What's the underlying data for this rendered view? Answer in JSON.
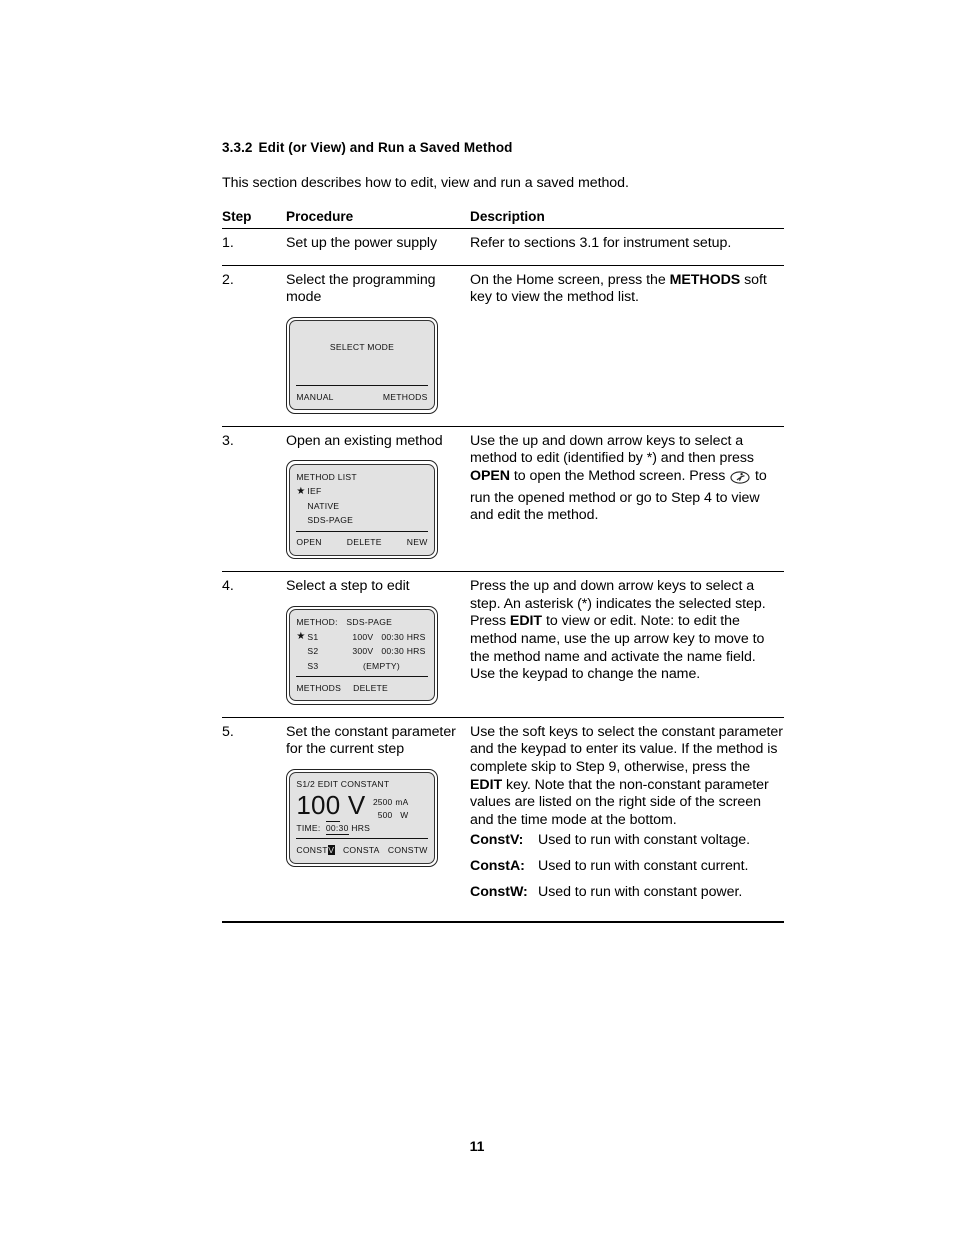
{
  "section": {
    "number": "3.3.2",
    "title": "Edit (or View) and Run a Saved Method",
    "intro": "This section describes how to edit, view and run a saved method."
  },
  "table": {
    "headers": {
      "step": "Step",
      "procedure": "Procedure",
      "description": "Description"
    },
    "rows": [
      {
        "step": "1.",
        "procedure": "Set up the power supply",
        "description": "Refer to sections 3.1 for instrument setup."
      },
      {
        "step": "2.",
        "procedure": "Select the programming mode",
        "desc_pre": "On the Home screen, press the ",
        "desc_bold": "METHODS",
        "desc_post": " soft key to view the method list."
      },
      {
        "step": "3.",
        "procedure": "Open an existing method",
        "desc_part1": "Use the up and down arrow keys to select a method to edit (identified by *) and then press ",
        "desc_bold": "OPEN",
        "desc_part2": " to open the Method screen. Press ",
        "desc_part3": " to run the opened method or go to Step 4 to view and edit the method."
      },
      {
        "step": "4.",
        "procedure": "Select a step to edit",
        "desc_part1": "Press the up and down arrow keys to select a step. An asterisk (*) indicates the selected step. Press ",
        "desc_bold": "EDIT",
        "desc_part2": " to view or edit. Note: to edit the method name, use the up arrow key to move to the method name and activate the name field. Use the keypad to change the name."
      },
      {
        "step": "5.",
        "procedure": "Set the constant parameter for the current step",
        "desc_part1": "Use the soft keys to select the constant parameter and the keypad to enter its value. If the method is complete skip to Step 9, otherwise, press the ",
        "desc_bold": "EDIT",
        "desc_part2": " key. Note that the non-constant parameter values are listed on the right side of the screen and the time mode at the bottom."
      }
    ]
  },
  "lcd_select_mode": {
    "title": "SELECT MODE",
    "softkeys": [
      "MANUAL",
      "METHODS"
    ]
  },
  "lcd_method_list": {
    "title": "METHOD LIST",
    "star": "★",
    "items": [
      {
        "selected": true,
        "name": "IEF"
      },
      {
        "selected": false,
        "name": "NATIVE"
      },
      {
        "selected": false,
        "name": "SDS-PAGE"
      }
    ],
    "softkeys": [
      "OPEN",
      "DELETE",
      "NEW"
    ]
  },
  "lcd_method_steps": {
    "label": "METHOD:",
    "method_name": "SDS-PAGE",
    "star": "★",
    "steps": [
      {
        "selected": true,
        "id": "S1",
        "volts": "100V",
        "time": "00:30 HRS"
      },
      {
        "selected": false,
        "id": "S2",
        "volts": "300V",
        "time": "00:30 HRS"
      },
      {
        "selected": false,
        "id": "S3",
        "empty": "(EMPTY)"
      }
    ],
    "softkeys": [
      "METHODS",
      "DELETE"
    ]
  },
  "lcd_edit_constant": {
    "title": "S1/2 EDIT CONSTANT",
    "value_lead": "10",
    "value_cursor": "0",
    "value_unit": "V",
    "side_values": [
      {
        "value": "2500",
        "unit": "mA"
      },
      {
        "value": "500",
        "unit": "W"
      }
    ],
    "time_label": "TIME:",
    "time_value": "00:30",
    "time_unit": "HRS",
    "softkeys": [
      {
        "text": "CONST",
        "highlight": "V"
      },
      {
        "text": "CONSTA",
        "highlight": ""
      },
      {
        "text": "CONSTW",
        "highlight": ""
      }
    ]
  },
  "definitions": [
    {
      "term": "ConstV:",
      "desc": "Used to run with constant voltage."
    },
    {
      "term": "ConstA:",
      "desc": "Used to run with constant current."
    },
    {
      "term": "ConstW:",
      "desc": "Used to run with constant power."
    }
  ],
  "footer": {
    "page_number": "11"
  },
  "icons": {
    "run_key": "run-key-icon"
  }
}
